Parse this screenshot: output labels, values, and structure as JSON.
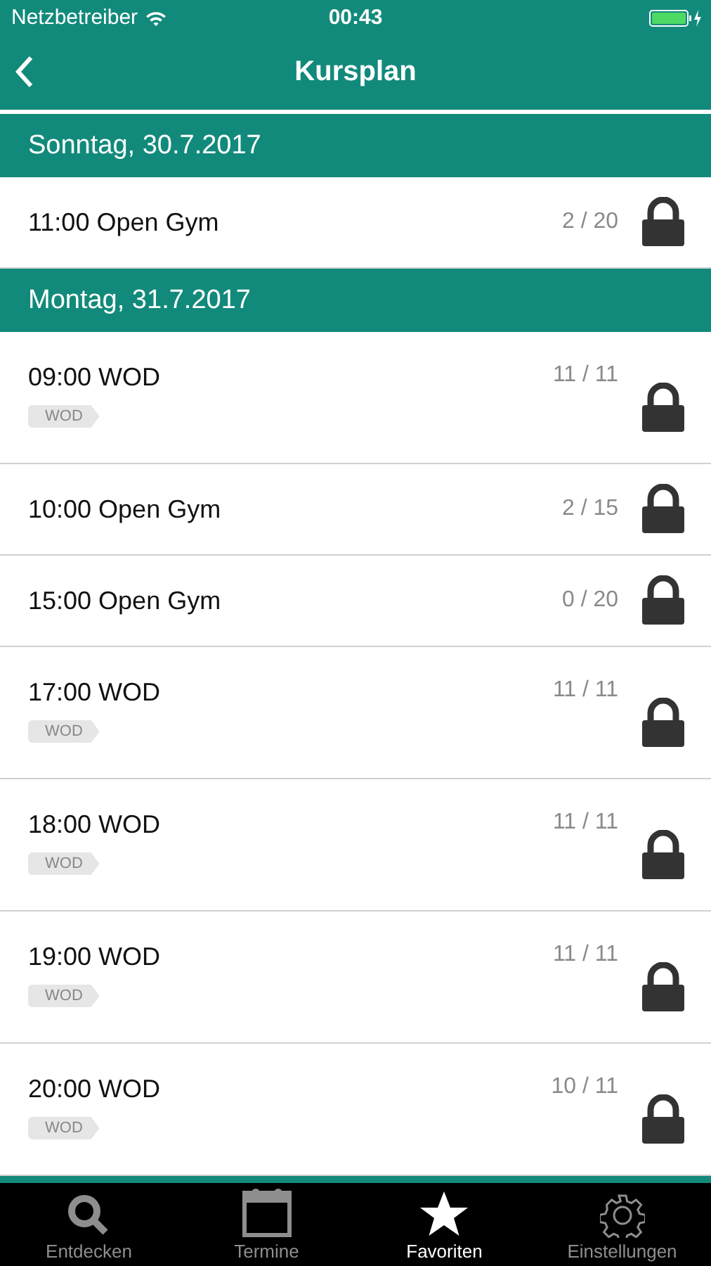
{
  "status_bar": {
    "carrier": "Netzbetreiber",
    "time": "00:43"
  },
  "nav": {
    "title": "Kursplan"
  },
  "days": [
    {
      "date": "Sonntag, 30.7.2017",
      "courses": [
        {
          "title": "11:00 Open Gym",
          "count": "2 / 20"
        }
      ]
    },
    {
      "date": "Montag, 31.7.2017",
      "courses": [
        {
          "title": "09:00 WOD",
          "count": "11 / 11",
          "tag": "WOD"
        },
        {
          "title": "10:00 Open Gym",
          "count": "2 / 15"
        },
        {
          "title": "15:00 Open Gym",
          "count": "0 / 20"
        },
        {
          "title": "17:00 WOD",
          "count": "11 / 11",
          "tag": "WOD"
        },
        {
          "title": "18:00 WOD",
          "count": "11 / 11",
          "tag": "WOD"
        },
        {
          "title": "19:00 WOD",
          "count": "11 / 11",
          "tag": "WOD"
        },
        {
          "title": "20:00 WOD",
          "count": "10 / 11",
          "tag": "WOD"
        }
      ]
    }
  ],
  "tabs": [
    {
      "kind": "search",
      "label": "Entdecken",
      "selected": false
    },
    {
      "kind": "calendar",
      "label": "Termine",
      "selected": false
    },
    {
      "kind": "star",
      "label": "Favoriten",
      "selected": true
    },
    {
      "kind": "gear",
      "label": "Einstellungen",
      "selected": false
    }
  ]
}
